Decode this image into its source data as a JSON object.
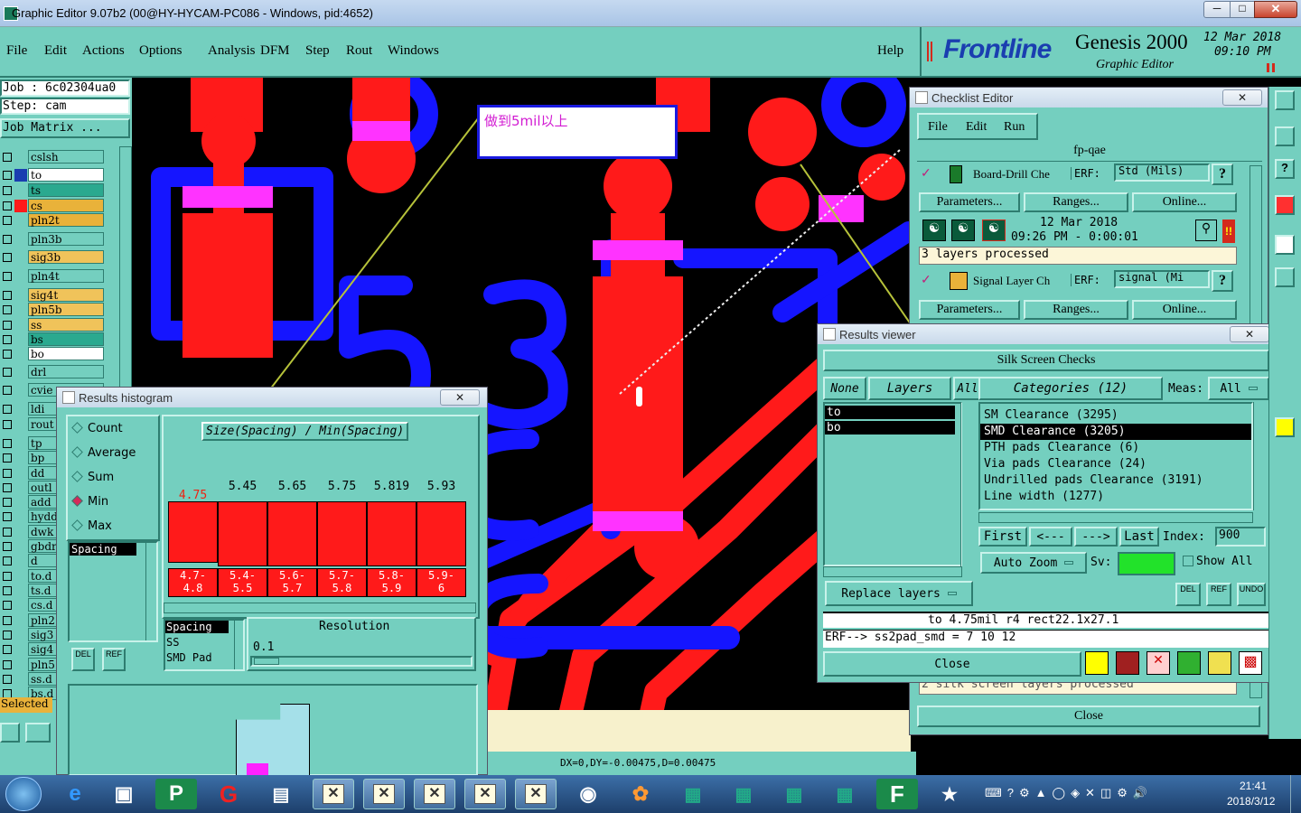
{
  "window": {
    "title": "Graphic Editor 9.07b2 (00@HY-HYCAM-PC086 - Windows, pid:4652)"
  },
  "menu": {
    "items": [
      "File",
      "Edit",
      "Actions",
      "Options",
      "Analysis",
      "DFM",
      "Step",
      "Rout",
      "Windows"
    ],
    "help": "Help"
  },
  "brand": {
    "logo": "Frontline",
    "product": "Genesis 2000",
    "subtitle": "Graphic Editor",
    "date": "12 Mar 2018",
    "time": "09:10 PM"
  },
  "job": {
    "job": "Job : 6c02304ua0",
    "step": "Step: cam",
    "matrix": "Job Matrix ..."
  },
  "layers": [
    {
      "name": "cslsh",
      "color": "#74cfbf"
    },
    {
      "name": "to",
      "color": "#ffffff"
    },
    {
      "name": "ts",
      "color": "#2aa98f"
    },
    {
      "name": "cs",
      "color": "#e9b23a"
    },
    {
      "name": "pln2t",
      "color": "#e9b23a"
    },
    {
      "name": "pln3b",
      "color": "#74cfbf"
    },
    {
      "name": "sig3b",
      "color": "#f0c35a"
    },
    {
      "name": "pln4t",
      "color": "#74cfbf"
    },
    {
      "name": "sig4t",
      "color": "#f0c35a"
    },
    {
      "name": "pln5b",
      "color": "#f0c35a"
    },
    {
      "name": "ss",
      "color": "#f0c35a"
    },
    {
      "name": "bs",
      "color": "#2aa98f"
    },
    {
      "name": "bo",
      "color": "#ffffff"
    },
    {
      "name": "drl",
      "color": "#74cfbf"
    },
    {
      "name": "cvie",
      "color": "#74cfbf"
    },
    {
      "name": "ldi",
      "color": "#74cfbf"
    },
    {
      "name": "rout",
      "color": "#74cfbf"
    },
    {
      "name": "tp",
      "color": "#74cfbf"
    },
    {
      "name": "bp",
      "color": "#74cfbf"
    },
    {
      "name": "dd",
      "color": "#74cfbf"
    },
    {
      "name": "outl",
      "color": "#74cfbf"
    },
    {
      "name": "add",
      "color": "#74cfbf"
    },
    {
      "name": "hydd",
      "color": "#74cfbf"
    },
    {
      "name": "dwk",
      "color": "#74cfbf"
    },
    {
      "name": "gbdr",
      "color": "#74cfbf"
    },
    {
      "name": "d",
      "color": "#74cfbf"
    },
    {
      "name": "to.d",
      "color": "#74cfbf"
    },
    {
      "name": "ts.d",
      "color": "#74cfbf"
    },
    {
      "name": "cs.d",
      "color": "#74cfbf"
    },
    {
      "name": "pln2",
      "color": "#74cfbf"
    },
    {
      "name": "sig3",
      "color": "#74cfbf"
    },
    {
      "name": "sig4",
      "color": "#74cfbf"
    },
    {
      "name": "pln5",
      "color": "#74cfbf"
    },
    {
      "name": "ss.d",
      "color": "#74cfbf"
    },
    {
      "name": "bs.d",
      "color": "#74cfbf"
    }
  ],
  "selected_label": "Selected",
  "annotation": {
    "text": "做到5mil以上"
  },
  "status": {
    "coords": "DX=0,DY=-0.00475,D=0.00475"
  },
  "histogram": {
    "title": "Results histogram",
    "options": [
      "Count",
      "Average",
      "Sum",
      "Min",
      "Max"
    ],
    "selected_option": "Min",
    "list_item": "Spacing",
    "chart_title": "Size(Spacing) / Min(Spacing)",
    "bar_values": [
      "4.75",
      "5.45",
      "5.65",
      "5.75",
      "5.819",
      "5.93"
    ],
    "bar_ranges": [
      "4.7-\n4.8",
      "5.4-\n5.5",
      "5.6-\n5.7",
      "5.7-\n5.8",
      "5.8-\n5.9",
      "5.9-\n6"
    ],
    "lower_list": [
      "Spacing",
      "SS",
      "SMD Pad"
    ],
    "resolution_label": "Resolution",
    "resolution_value": "0.1",
    "del": "DEL",
    "ref": "REF"
  },
  "checklist": {
    "title": "Checklist Editor",
    "menu": [
      "File",
      "Edit",
      "Run"
    ],
    "name": "fp-qae",
    "check1": {
      "name": "Board-Drill Che",
      "erf_label": "ERF:",
      "erf": "Std (Mils)",
      "q": "?"
    },
    "buttons1": [
      "Parameters...",
      "Ranges...",
      "Online..."
    ],
    "run_date": "12 Mar 2018",
    "run_time": "09:26 PM - 0:00:01",
    "processed1": "3 layers processed",
    "check2": {
      "name": "Signal Layer Ch",
      "erf_label": "ERF:",
      "erf": "signal (Mi",
      "q": "?"
    },
    "buttons2": [
      "Parameters...",
      "Ranges...",
      "Online..."
    ],
    "processed2": "2 silk screen layers processed",
    "close": "Close"
  },
  "results": {
    "title": "Results viewer",
    "heading": "Silk Screen Checks",
    "none": "None",
    "layers": "Layers",
    "all": "All",
    "categories_label": "Categories (12)",
    "meas_label": "Meas:",
    "meas_value": "All",
    "layer_list": [
      "to",
      "bo"
    ],
    "categories": [
      "SM Clearance (3295)",
      "SMD Clearance (3205)",
      "PTH pads Clearance (6)",
      "Via pads Clearance (24)",
      "Undrilled pads Clearance (3191)",
      "Line width (1277)"
    ],
    "selected_category": "SMD Clearance (3205)",
    "nav": [
      "First",
      "<---",
      "--->",
      "Last"
    ],
    "index_label": "Index:",
    "index_value": "900",
    "auto_zoom": "Auto Zoom",
    "sv_label": "Sv:",
    "show_all": "Show All",
    "replace_layers": "Replace layers",
    "del": "DEL",
    "ref": "REF",
    "undo": "UNDO",
    "info1": "to 4.75mil  r4  rect22.1x27.1",
    "info2": "ERF--> ss2pad_smd = 7 10 12",
    "close": "Close"
  },
  "clock": {
    "time": "21:41",
    "date": "2018/3/12"
  }
}
